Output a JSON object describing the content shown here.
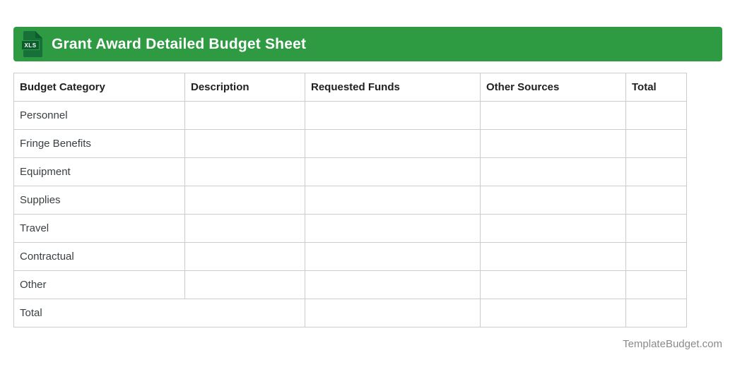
{
  "header": {
    "icon_label": "XLS",
    "title": "Grant Award Detailed Budget Sheet"
  },
  "table": {
    "columns": [
      "Budget Category",
      "Description",
      "Requested Funds",
      "Other Sources",
      "Total"
    ],
    "rows": [
      {
        "category": "Personnel"
      },
      {
        "category": "Fringe Benefits"
      },
      {
        "category": "Equipment"
      },
      {
        "category": "Supplies"
      },
      {
        "category": "Travel"
      },
      {
        "category": "Contractual"
      },
      {
        "category": "Other"
      }
    ],
    "footer": {
      "label": "Total"
    }
  },
  "footer": {
    "watermark": "TemplateBudget.com"
  },
  "colors": {
    "header_bar": "#2e9b43",
    "icon_document": "#17703a",
    "icon_band": "#0b5e2b",
    "title_text": "#ffffff",
    "table_border": "#cccccc",
    "header_text": "#212121",
    "body_text": "#3c4043",
    "watermark_text": "#8a8a8a"
  }
}
